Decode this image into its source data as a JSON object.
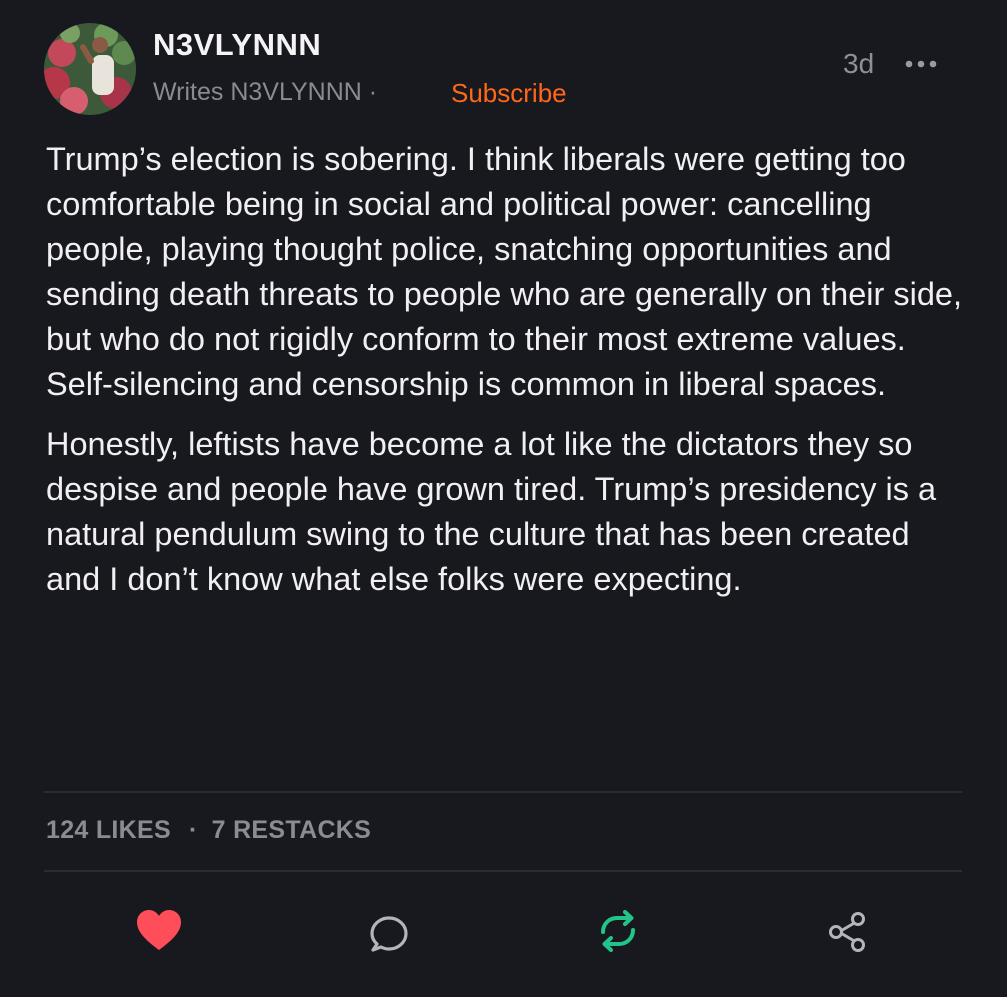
{
  "author": {
    "name": "N3VLYNNN",
    "byline": "Writes N3VLYNNN ·",
    "subscribe_label": "Subscribe",
    "avatar_icon": "profile-photo"
  },
  "post": {
    "timestamp": "3d",
    "more_icon": "more-horizontal-icon",
    "paragraphs": [
      "Trump’s election is sobering. I think liberals were getting too comfortable being in social and political power: cancelling people, playing thought police, snatching opportunities and sending death threats to people who are generally on their side, but who do not rigidly conform to their most extreme values. Self-silencing and censorship is common in liberal spaces.",
      "Honestly, leftists have become a lot like the dictators they so despise and people have grown tired. Trump’s presidency is a natural pendulum swing to the culture that has been created and I don’t know what else folks were expecting."
    ]
  },
  "stats": {
    "likes": "124 LIKES",
    "separator": "·",
    "restacks": "7 RESTACKS"
  },
  "actions": {
    "like_icon": "heart-icon",
    "comment_icon": "comment-icon",
    "restack_icon": "restack-icon",
    "share_icon": "share-icon"
  },
  "colors": {
    "background": "#18181f",
    "subscribe": "#ff6719",
    "like": "#ff4d5a",
    "restack": "#22c48a",
    "muted": "#8a8a92"
  }
}
